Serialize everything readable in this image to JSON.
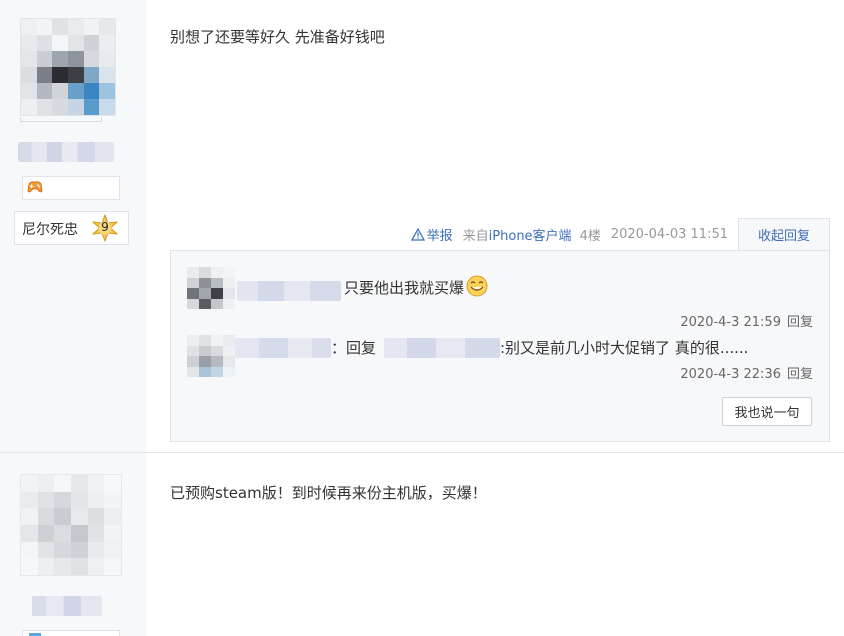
{
  "posts": [
    {
      "author": {
        "badge_icon": "game-controller-icon",
        "level_title": "尼尔死忠",
        "level": "9"
      },
      "content": "别想了还要等好久 先准备好钱吧",
      "tail": {
        "report_label": "举报",
        "client_prefix": "来自",
        "client_name": "iPhone客户端",
        "floor": "4楼",
        "time": "2020-04-03 11:51",
        "collapse_label": "收起回复"
      },
      "replies": [
        {
          "text": "只要他出我就买爆",
          "emoji": "smile-emoji-icon",
          "time": "2020-4-3 21:59",
          "reply_label": "回复"
        },
        {
          "prefix": "：回复",
          "text": ":别又是前几小时大促销了 真的很......",
          "time": "2020-4-3 22:36",
          "reply_label": "回复"
        }
      ],
      "say_button": "我也说一句"
    },
    {
      "content": "已预购steam版！到时候再来份主机版，买爆！"
    }
  ],
  "colors": {
    "link": "#3e6fb8",
    "sidebar_bg": "#f7f8fa",
    "reply_bg": "#f7f8fa",
    "border": "#e1e4ea"
  }
}
